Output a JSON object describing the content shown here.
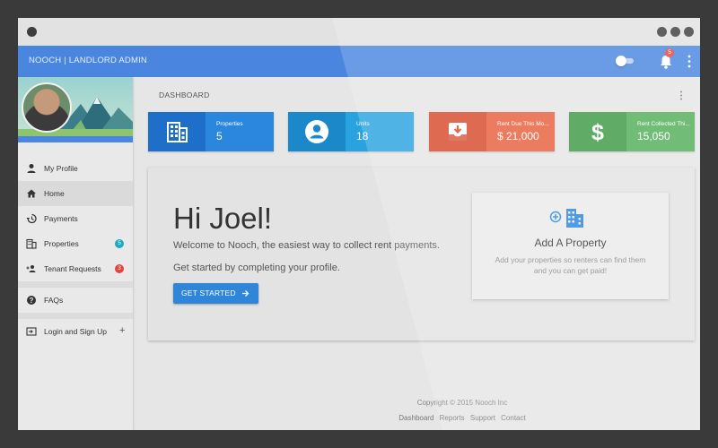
{
  "app_title": "NOOCH | LANDLORD ADMIN",
  "notifications_count": "5",
  "sidebar": {
    "items": [
      {
        "label": "My Profile"
      },
      {
        "label": "Home"
      },
      {
        "label": "Payments"
      },
      {
        "label": "Properties",
        "count": "5",
        "count_color": "#1ba9c7"
      },
      {
        "label": "Tenant Requests",
        "count": "3",
        "count_color": "#e2453c"
      },
      {
        "label": "FAQs"
      },
      {
        "label": "Login and Sign Up",
        "action": "+"
      }
    ]
  },
  "dashboard": {
    "title": "DASHBOARD",
    "stats": [
      {
        "label": "Properties",
        "value": "5",
        "icon": "building-icon",
        "color_dark": "#1e6fc9",
        "color_light": "#2b86dd"
      },
      {
        "label": "Units",
        "value": "18",
        "icon": "person-circle-icon",
        "color_dark": "#1b88c9",
        "color_light": "#29a3e0"
      },
      {
        "label": "Rent Due This Mo...",
        "value": "$ 21,000",
        "icon": "inbox-download-icon",
        "color_dark": "#d64a2b",
        "color_light": "#e8603c"
      },
      {
        "label": "Rent Collected Thi...",
        "value": "15,050",
        "icon": "dollar-icon",
        "color_dark": "#3e9945",
        "color_light": "#52ae58"
      }
    ]
  },
  "hero": {
    "greeting": "Hi Joel!",
    "welcome": "Welcome to Nooch, the easiest way to collect rent payments.",
    "getstarted_text": "Get started by completing your profile.",
    "button_label": "GET STARTED"
  },
  "add_property": {
    "title": "Add A Property",
    "description": "Add your properties so renters can find them and you can get paid!"
  },
  "footer": {
    "copyright": "Copyright © 2015 Nooch Inc",
    "links": [
      "Dashboard",
      "Reports",
      "Support",
      "Contact"
    ]
  },
  "colors": {
    "appbar": "#4a86e0",
    "button": "#2f86d8"
  }
}
